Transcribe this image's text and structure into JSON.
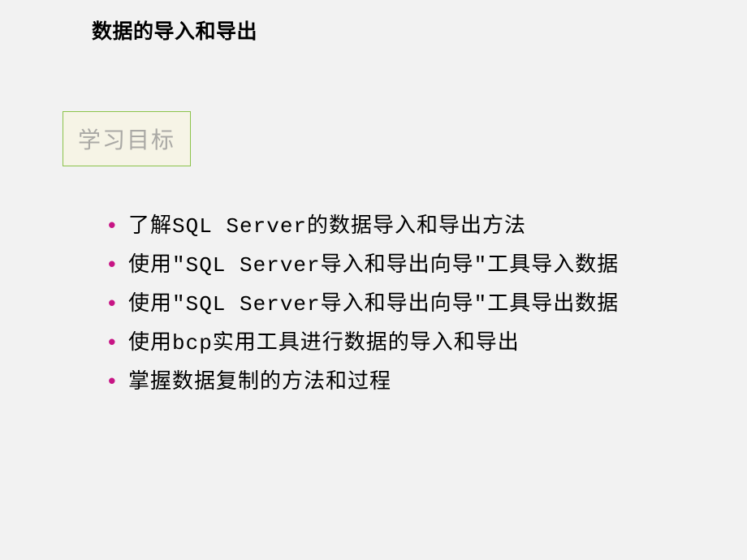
{
  "title": "数据的导入和导出",
  "section_label": "学习目标",
  "bullets": [
    "了解SQL Server的数据导入和导出方法",
    "使用\"SQL Server导入和导出向导\"工具导入数据",
    "使用\"SQL Server导入和导出向导\"工具导出数据",
    "使用bcp实用工具进行数据的导入和导出",
    "掌握数据复制的方法和过程"
  ]
}
